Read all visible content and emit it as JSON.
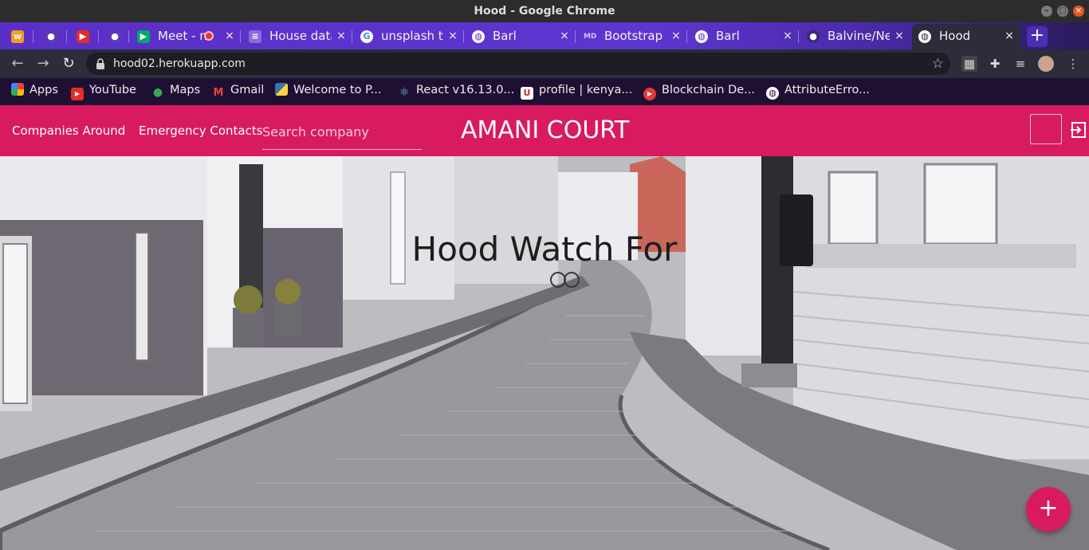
{
  "window": {
    "title": "Hood - Google Chrome"
  },
  "tabs": [
    {
      "label": "",
      "icon": "w-icon"
    },
    {
      "label": "",
      "icon": "github-icon"
    },
    {
      "label": "",
      "icon": "youtube-icon"
    },
    {
      "label": "",
      "icon": "github-icon"
    },
    {
      "label": "Meet - n",
      "icon": "meet-icon"
    },
    {
      "label": "House data",
      "icon": "database-icon"
    },
    {
      "label": "unsplash te",
      "icon": "google-icon"
    },
    {
      "label": "Barl",
      "icon": "globe-icon"
    },
    {
      "label": "Bootstrap",
      "icon": "md-icon"
    },
    {
      "label": "Barl",
      "icon": "globe-icon"
    },
    {
      "label": "Balvine/Ne",
      "icon": "github-icon"
    },
    {
      "label": "Hood",
      "icon": "globe-icon"
    }
  ],
  "address_bar": {
    "url": "hood02.herokuapp.com"
  },
  "bookmarks": [
    {
      "label": "Apps",
      "icon": "apps-grid-icon"
    },
    {
      "label": "YouTube",
      "icon": "youtube-icon"
    },
    {
      "label": "Maps",
      "icon": "maps-icon"
    },
    {
      "label": "Gmail",
      "icon": "gmail-icon"
    },
    {
      "label": "Welcome to P...",
      "icon": "python-icon"
    },
    {
      "label": "React v16.13.0...",
      "icon": "react-icon"
    },
    {
      "label": "profile | kenya...",
      "icon": "profile-icon"
    },
    {
      "label": "Blockchain De...",
      "icon": "blockchain-icon"
    },
    {
      "label": "AttributeErro...",
      "icon": "globe-icon"
    }
  ],
  "site": {
    "nav": {
      "companies_label": "Companies Around",
      "emergency_label": "Emergency Contacts",
      "search_placeholder": "Search company",
      "brand": "AMANI COURT"
    },
    "hero": {
      "title": "Hood Watch For"
    },
    "fab_label": "+"
  },
  "colors": {
    "primary": "#d81b60",
    "tabstrip": "#5a2fc7",
    "bookmark_bar": "#1f0f33"
  }
}
